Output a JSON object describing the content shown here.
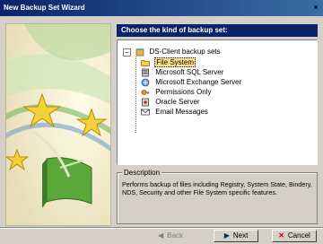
{
  "window": {
    "title": "New Backup Set Wizard",
    "close_glyph": "×"
  },
  "heading": "Choose the kind of backup set:",
  "tree": {
    "root": {
      "label": "DS-Client backup sets",
      "expander": "−"
    },
    "items": [
      {
        "label": "File System",
        "icon": "folder-icon",
        "selected": true
      },
      {
        "label": "Microsoft SQL Server",
        "icon": "sql-server-icon"
      },
      {
        "label": "Microsoft Exchange Server",
        "icon": "exchange-server-icon"
      },
      {
        "label": "Permissions Only",
        "icon": "permissions-icon"
      },
      {
        "label": "Oracle Server",
        "icon": "oracle-server-icon"
      },
      {
        "label": "Email Messages",
        "icon": "email-icon"
      }
    ]
  },
  "description": {
    "legend": "Description",
    "text": "Performs backup of files including Registry, System State, Bindery, NDS, Security and other File System specific features."
  },
  "buttons": {
    "back": "Back",
    "next": "Next",
    "cancel": "Cancel"
  },
  "colors": {
    "title_bar": "#0a246a",
    "selection": "#ffe08a",
    "face": "#d4d0c8"
  }
}
